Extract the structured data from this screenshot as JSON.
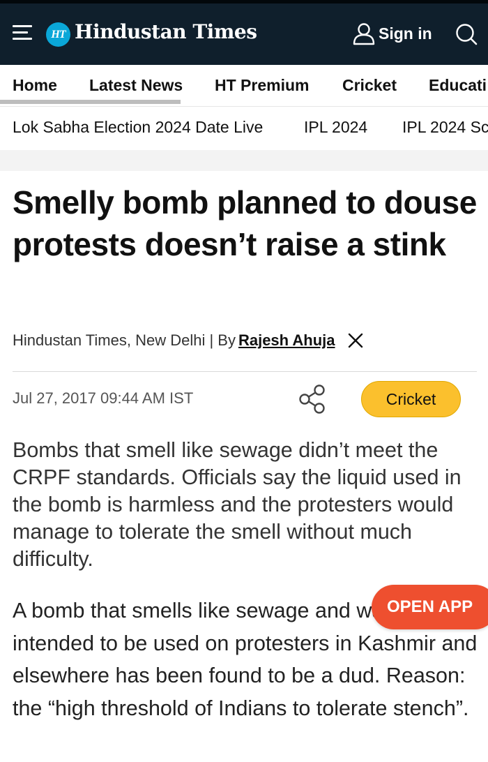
{
  "header": {
    "logo_badge": "HT",
    "logo_text": "Hindustan Times",
    "sign_in_label": "Sign in",
    "bg_color": "#0f1f2c",
    "logo_badge_color": "#0aa7d8"
  },
  "nav": {
    "items": [
      "Home",
      "Latest News",
      "HT Premium",
      "Cricket",
      "Educati"
    ]
  },
  "topics": {
    "items": [
      "Lok Sabha Election 2024 Date Live",
      "IPL 2024",
      "IPL 2024 Sc"
    ]
  },
  "article": {
    "headline": "Smelly bomb planned to douse protests doesn’t raise a stink",
    "byline_prefix": "Hindustan Times, New Delhi | By",
    "author": "Rajesh Ahuja",
    "dateline": "Jul 27, 2017 09:44 AM IST",
    "tag": "Cricket",
    "tag_color": "#fbc02d",
    "summary": "Bombs that smell like sewage didn’t meet the CRPF standards. Officials say the liquid used in the bomb is harmless and the protesters would manage to tolerate the smell without much difficulty.",
    "body": "A bomb that smells like sewage and was intended to be used on protesters in Kashmir and elsewhere has been found to be a dud. Reason: the “high threshold of Indians to tolerate stench”."
  },
  "cta": {
    "open_app_label": "OPEN APP",
    "color": "#ee4f2f"
  }
}
